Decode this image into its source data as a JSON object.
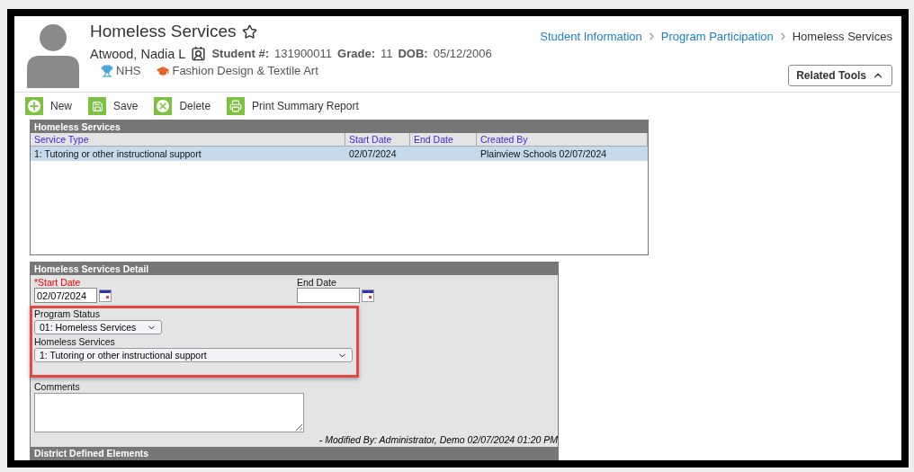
{
  "header": {
    "title": "Homeless Services",
    "favorite": false,
    "student_name": "Atwood, Nadia L",
    "student_number_label": "Student #:",
    "student_number": "131900011",
    "grade_label": "Grade:",
    "grade": "11",
    "dob_label": "DOB:",
    "dob": "05/12/2006",
    "badges": [
      {
        "kind": "trophy",
        "label": "NHS",
        "color": "#4aa8d8"
      },
      {
        "kind": "career",
        "label": "Fashion Design & Textile Art",
        "color": "#e8622c"
      }
    ]
  },
  "breadcrumb": [
    {
      "label": "Student Information",
      "current": false
    },
    {
      "label": "Program Participation",
      "current": false
    },
    {
      "label": "Homeless Services",
      "current": true
    }
  ],
  "related_tools": {
    "label": "Related Tools",
    "expanded": true
  },
  "toolbar": [
    {
      "kind": "new",
      "label": "New"
    },
    {
      "kind": "save",
      "label": "Save"
    },
    {
      "kind": "delete",
      "label": "Delete"
    },
    {
      "kind": "print",
      "label": "Print Summary Report"
    }
  ],
  "list": {
    "title": "Homeless Services",
    "columns": [
      "Service Type",
      "Start Date",
      "End Date",
      "Created By"
    ],
    "rows": [
      {
        "cells": [
          "1: Tutoring or other instructional support",
          "02/07/2024",
          "",
          "Plainview Schools 02/07/2024"
        ],
        "selected": true
      }
    ]
  },
  "detail": {
    "title": "Homeless Services Detail",
    "start_date_label": "*Start Date",
    "start_date": "02/07/2024",
    "end_date_label": "End Date",
    "program_status_label": "Program Status",
    "program_status": "01: Homeless Services",
    "services_label": "Homeless Services",
    "services": "1: Tutoring or other instructional support",
    "comments_label": "Comments",
    "modified": "- Modified By: Administrator, Demo 02/07/2024 01:20 PM",
    "footer_title": "District Defined Elements"
  }
}
